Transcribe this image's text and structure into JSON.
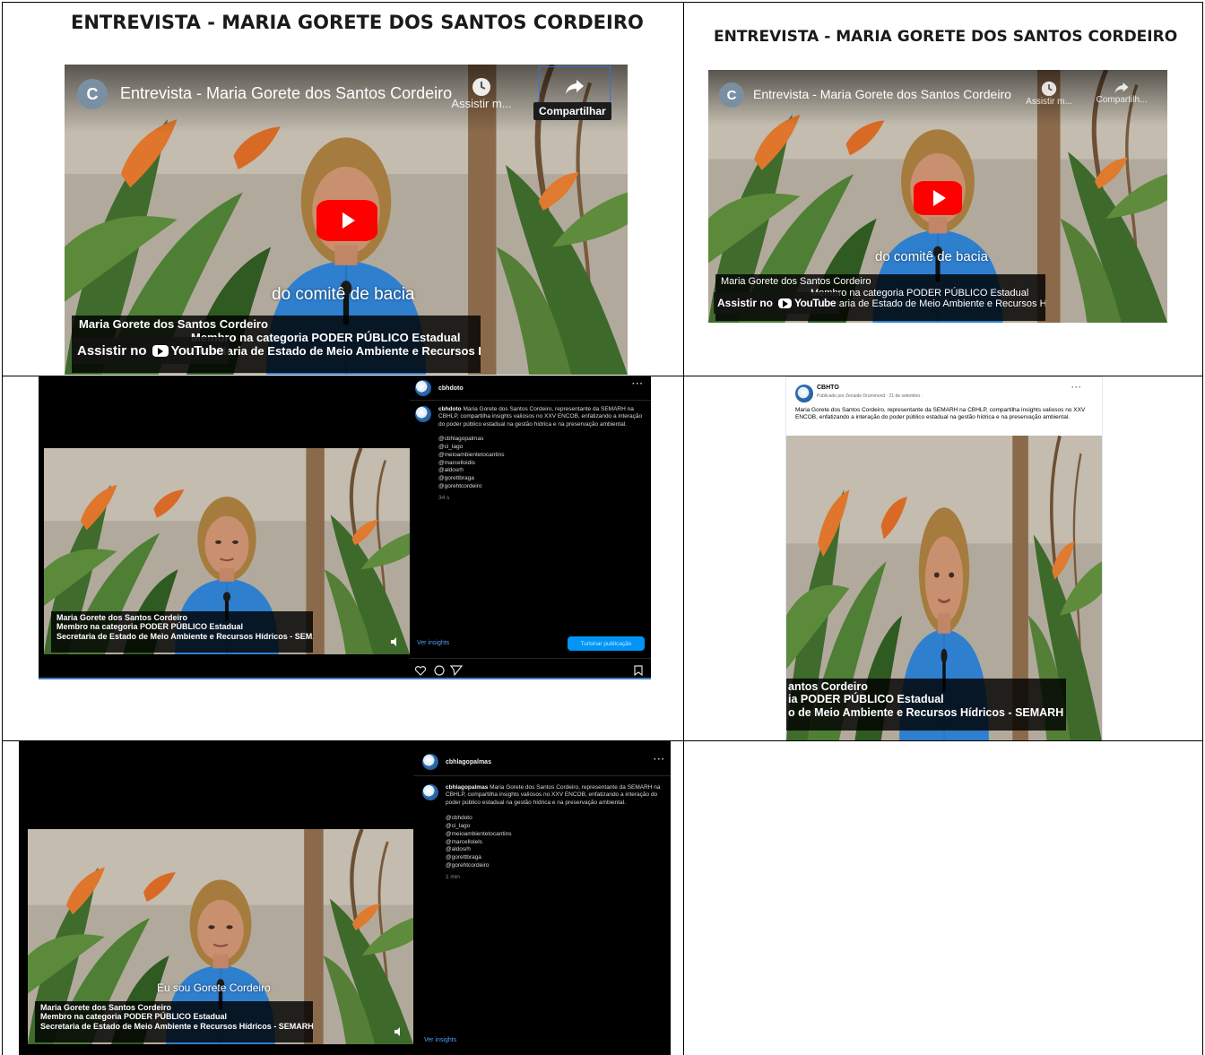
{
  "doc": {
    "title_main": "ENTREVISTA - MARIA GORETE DOS SANTOS CORDEIRO",
    "title_right": "ENTREVISTA - MARIA GORETE DOS SANTOS CORDEIRO"
  },
  "youtube_large": {
    "channel_initial": "C",
    "video_title": "Entrevista - Maria Gorete dos Santos Cordeiro",
    "watch_later_label": "Assistir m...",
    "share_label": "Compartilhar",
    "share_tooltip": "Compartilhar",
    "subtitle": "do comitê de bacia",
    "lower_third": [
      "Maria Gorete dos Santos Cordeiro",
      "Membro na categoria PODER PÚBLICO Estadual",
      "Secretaria de Estado de Meio Ambiente e Recursos Hídricos - SEMARH"
    ],
    "watch_on": "Assistir no",
    "youtube_brand": "YouTube"
  },
  "youtube_small": {
    "channel_initial": "C",
    "video_title": "Entrevista - Maria Gorete dos Santos Cordeiro",
    "watch_later_label": "Assistir m...",
    "share_label": "Compartilh...",
    "subtitle": "do comitê de bacia",
    "lower_third": [
      "Maria Gorete dos Santos Cordeiro",
      "Membro na categoria PODER PÚBLICO Estadual",
      "Secretaria de Estado de Meio Ambiente e Recursos Hídricos - SEMARH"
    ],
    "watch_on": "Assistir no",
    "youtube_brand": "YouTube"
  },
  "instagram_1": {
    "username": "cbhdoto",
    "caption_user": "cbhdoto",
    "caption": "Maria Gorete dos Santos Cordeiro, representante da SEMARH na CBHLP, compartilha insights valiosos no XXV ENCOB, enfatizando a interação do poder público estadual na gestão hídrica e na preservação ambiental.",
    "tags": [
      "@cbhlagopalmas",
      "@ci_lago",
      "@meioambientetocantins",
      "@marcelloidis",
      "@aldosrh",
      "@gorettbraga",
      "@gorehtcordeiro"
    ],
    "time": "34 s",
    "lower_third": [
      "Maria Gorete dos Santos Cordeiro",
      "Membro na categoria PODER PÚBLICO Estadual",
      "Secretaria de Estado de Meio Ambiente e Recursos Hídricos - SEMARH"
    ],
    "insights_link": "Ver insights",
    "boost_button": "Turbinar publicação"
  },
  "facebook": {
    "page_name": "CBHTO",
    "meta": "Publicado por Zenaide Drummond · 21 de setembro ·",
    "caption": "Maria Gorete dos Santos Cordeiro, representante da SEMARH na CBHLP, compartilha insights valiosos no XXV ENCOB, enfatizando a interação do poder público estadual na gestão hídrica e na preservação ambiental.",
    "lower_third": [
      "antos Cordeiro",
      "ia PODER PÚBLICO Estadual",
      "o de Meio Ambiente e Recursos Hídricos - SEMARH"
    ]
  },
  "instagram_2": {
    "username": "cbhlagopalmas",
    "caption_user": "cbhlagopalmas",
    "caption": "Maria Gorete dos Santos Cordeiro, representante da SEMARH na CBHLP, compartilha insights valiosos no XXV ENCOB, enfatizando a interação do poder público estadual na gestão hídrica e na preservação ambiental.",
    "tags": [
      "@cbhdoto",
      "@ci_lago",
      "@meioambientetocantins",
      "@marcellolels",
      "@aldosrh",
      "@gorettbraga",
      "@gorehtcordeiro"
    ],
    "time": "1 min",
    "subtitle": "Eu sou Gorete Cordeiro",
    "lower_third": [
      "Maria Gorete dos Santos Cordeiro",
      "Membro na categoria PODER PÚBLICO Estadual",
      "Secretaria de Estado de Meio Ambiente e Recursos Hídricos - SEMARH"
    ],
    "insights_link": "Ver insights"
  },
  "colors": {
    "youtube_red": "#ff0000",
    "instagram_blue": "#0095f6",
    "shirt_blue": "#2f7fcf"
  }
}
